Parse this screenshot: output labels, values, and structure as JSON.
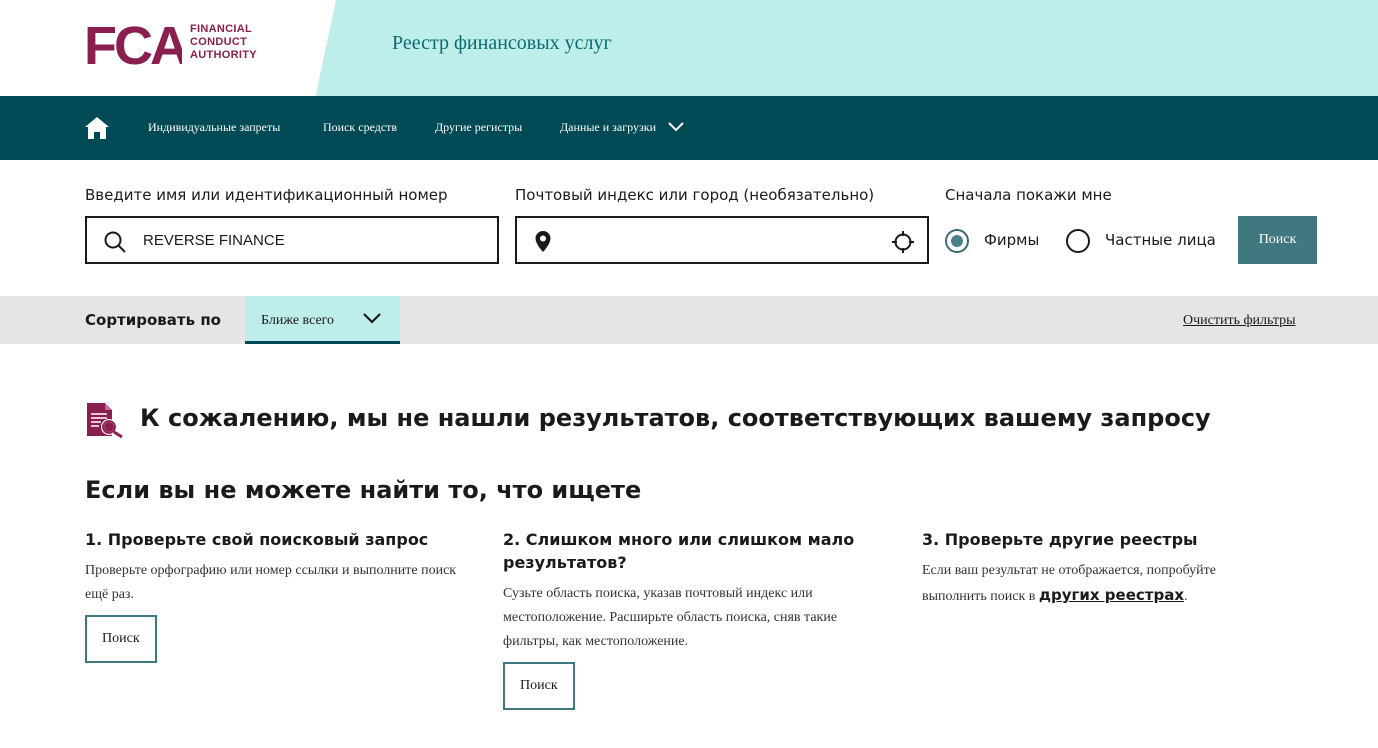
{
  "brand": {
    "logo_letters": "FCA",
    "logo_lines": [
      "FINANCIAL",
      "CONDUCT",
      "AUTHORITY"
    ],
    "site_title": "Реестр финансовых услуг",
    "colors": {
      "brand": "#8a1e4f",
      "header_band": "#bdeeea",
      "nav": "#004a55",
      "accent": "#3f7880"
    }
  },
  "nav": {
    "home_icon": "home-icon",
    "items": [
      {
        "label": "Индивидуальные запреты"
      },
      {
        "label": "Поиск средств"
      },
      {
        "label": "Другие регистры"
      },
      {
        "label": "Данные и загрузки",
        "icon": "chevron-down-icon"
      }
    ]
  },
  "search": {
    "name_label": "Введите имя или идентификационный номер",
    "name_value": "REVERSE FINANCE",
    "name_icon": "search-icon",
    "location_label": "Почтовый индекс или город (необязательно)",
    "location_value": "",
    "location_icon": "map-pin-icon",
    "locate_icon": "crosshair-icon",
    "show_first_label": "Сначала покажи мне",
    "options": [
      {
        "label": "Фирмы",
        "selected": true
      },
      {
        "label": "Частные лица",
        "selected": false
      }
    ],
    "button_label": "Поиск"
  },
  "sort": {
    "label": "Сортировать по",
    "selected": "Ближе всего",
    "clear_filters": "Очистить фильтры"
  },
  "results": {
    "no_results_icon": "document-search-icon",
    "no_results_title": "К сожалению, мы не нашли результатов, соответствующих вашему запросу",
    "help_title": "Если вы не можете найти то, что ищете",
    "columns": [
      {
        "title": "1. Проверьте свой поисковый запрос",
        "text": "Проверьте орфографию или номер ссылки и выполните поиск ещё раз.",
        "button": "Поиск"
      },
      {
        "title": "2. Слишком много или слишком мало результатов?",
        "text": "Сузьте область поиска, указав почтовый индекс или местоположение. Расширьте область поиска, сняв такие фильтры, как местоположение.",
        "button": "Поиск"
      },
      {
        "title": "3. Проверьте другие реестры",
        "text": "Если ваш результат не отображается, попробуйте выполнить поиск в",
        "link": "других реестрах",
        "after_link": "."
      }
    ]
  }
}
